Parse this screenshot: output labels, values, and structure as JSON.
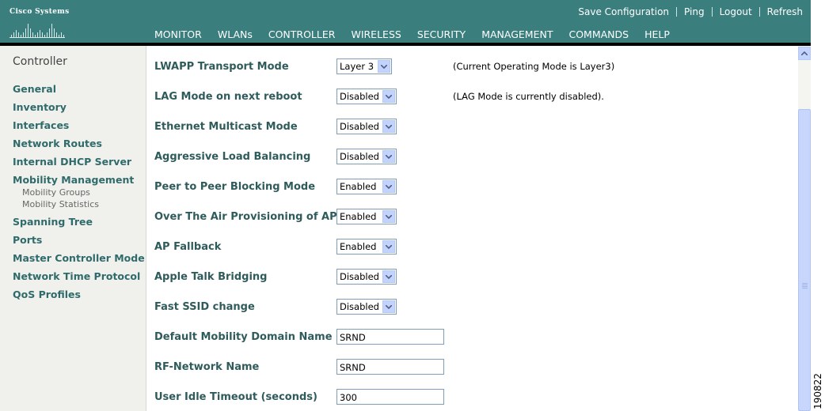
{
  "header": {
    "logo_text": "Cisco Systems",
    "top_links": [
      "Save Configuration",
      "Ping",
      "Logout",
      "Refresh"
    ],
    "nav_tabs": [
      "MONITOR",
      "WLANs",
      "CONTROLLER",
      "WIRELESS",
      "SECURITY",
      "MANAGEMENT",
      "COMMANDS",
      "HELP"
    ],
    "active_tab": "CONTROLLER",
    "colors": {
      "header_bg": "#3a7e7e",
      "active_tab_underline": "#f7a824"
    }
  },
  "sidebar": {
    "title": "Controller",
    "items": [
      "General",
      "Inventory",
      "Interfaces",
      "Network Routes",
      "Internal DHCP Server",
      "Mobility Management",
      "Spanning Tree",
      "Ports",
      "Master Controller Mode",
      "Network Time Protocol",
      "QoS Profiles"
    ],
    "subitems": [
      "Mobility Groups",
      "Mobility Statistics"
    ]
  },
  "form": {
    "rows": [
      {
        "label": "LWAPP Transport Mode",
        "value": "Layer 3",
        "note": "(Current Operating Mode is Layer3)"
      },
      {
        "label": "LAG Mode on next reboot",
        "value": "Disabled",
        "note": "(LAG Mode is currently disabled)."
      },
      {
        "label": "Ethernet Multicast Mode",
        "value": "Disabled"
      },
      {
        "label": "Aggressive Load Balancing",
        "value": "Disabled"
      },
      {
        "label": "Peer to Peer Blocking Mode",
        "value": "Enabled"
      },
      {
        "label": "Over The Air Provisioning of AP",
        "value": "Enabled"
      },
      {
        "label": "AP Fallback",
        "value": "Enabled"
      },
      {
        "label": "Apple Talk Bridging",
        "value": "Disabled"
      },
      {
        "label": "Fast SSID change",
        "value": "Disabled"
      },
      {
        "label": "Default Mobility Domain Name",
        "value": "SRND"
      },
      {
        "label": "RF-Network Name",
        "value": "SRND"
      },
      {
        "label": "User Idle Timeout (seconds)",
        "value": "300"
      }
    ]
  },
  "figure_code": "190822"
}
